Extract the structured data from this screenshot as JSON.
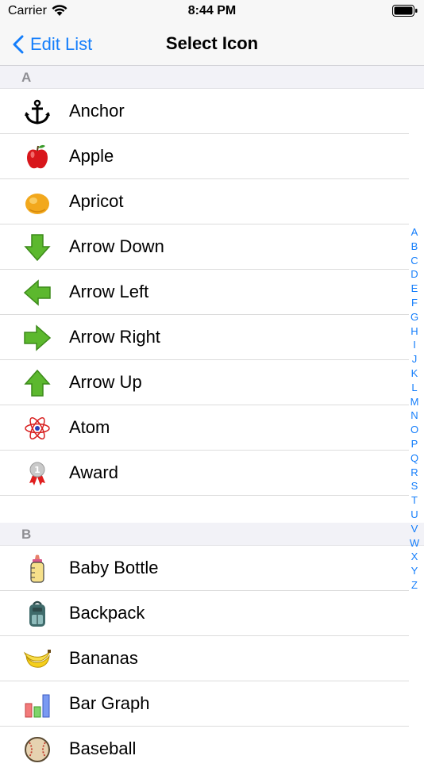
{
  "status": {
    "carrier": "Carrier",
    "time": "8:44 PM"
  },
  "nav": {
    "back_label": "Edit List",
    "title": "Select Icon"
  },
  "sections": [
    {
      "letter": "A",
      "items": [
        {
          "label": "Anchor",
          "icon": "anchor-icon"
        },
        {
          "label": "Apple",
          "icon": "apple-icon"
        },
        {
          "label": "Apricot",
          "icon": "apricot-icon"
        },
        {
          "label": "Arrow Down",
          "icon": "arrow-down-icon"
        },
        {
          "label": "Arrow Left",
          "icon": "arrow-left-icon"
        },
        {
          "label": "Arrow Right",
          "icon": "arrow-right-icon"
        },
        {
          "label": "Arrow Up",
          "icon": "arrow-up-icon"
        },
        {
          "label": "Atom",
          "icon": "atom-icon"
        },
        {
          "label": "Award",
          "icon": "award-icon"
        }
      ]
    },
    {
      "letter": "B",
      "items": [
        {
          "label": "Baby Bottle",
          "icon": "baby-bottle-icon"
        },
        {
          "label": "Backpack",
          "icon": "backpack-icon"
        },
        {
          "label": "Bananas",
          "icon": "bananas-icon"
        },
        {
          "label": "Bar Graph",
          "icon": "bar-graph-icon"
        },
        {
          "label": "Baseball",
          "icon": "baseball-icon"
        }
      ]
    }
  ],
  "index_letters": [
    "A",
    "B",
    "C",
    "D",
    "E",
    "F",
    "G",
    "H",
    "I",
    "J",
    "K",
    "L",
    "M",
    "N",
    "O",
    "P",
    "Q",
    "R",
    "S",
    "T",
    "U",
    "V",
    "W",
    "X",
    "Y",
    "Z"
  ],
  "colors": {
    "accent": "#147efb",
    "section_bg": "#f2f2f7",
    "separator": "#dcdcdc"
  }
}
